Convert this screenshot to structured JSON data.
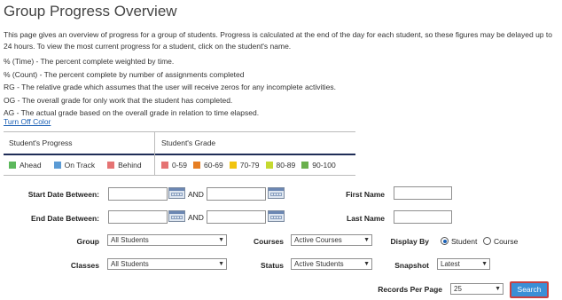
{
  "page": {
    "title": "Group Progress Overview",
    "description": "This page gives an overview of progress for a group of students. Progress is calculated at the end of the day for each student, so these figures may be delayed up to 24 hours. To view the most current progress for a student, click on the student's name.",
    "definitions": [
      "% (Time) - The percent complete weighted by time.",
      "% (Count) - The percent complete by number of assignments completed",
      "RG - The relative grade which assumes that the user will receive zeros for any incomplete activities.",
      "OG - The overall grade for only work that the student has completed.",
      "AG - The actual grade based on the overall grade in relation to time elapsed."
    ],
    "turn_off_color": "Turn Off Color"
  },
  "legend": {
    "progress_header": "Student's Progress",
    "grade_header": "Student's Grade",
    "progress_items": [
      {
        "label": "Ahead",
        "color": "#5cb85c"
      },
      {
        "label": "On Track",
        "color": "#5b9bd5"
      },
      {
        "label": "Behind",
        "color": "#e57373"
      }
    ],
    "grade_items": [
      {
        "label": "0-59",
        "color": "#e57373"
      },
      {
        "label": "60-69",
        "color": "#e67e22"
      },
      {
        "label": "70-79",
        "color": "#f1c40f"
      },
      {
        "label": "80-89",
        "color": "#c5d930"
      },
      {
        "label": "90-100",
        "color": "#6ab04c"
      }
    ]
  },
  "form": {
    "start_date_label": "Start Date Between:",
    "end_date_label": "End Date Between:",
    "and": "AND",
    "first_name_label": "First Name",
    "last_name_label": "Last Name",
    "group_label": "Group",
    "group_value": "All Students",
    "courses_label": "Courses",
    "courses_value": "Active Courses",
    "display_by_label": "Display By",
    "display_student": "Student",
    "display_course": "Course",
    "classes_label": "Classes",
    "classes_value": "All Students",
    "status_label": "Status",
    "status_value": "Active Students",
    "snapshot_label": "Snapshot",
    "snapshot_value": "Latest",
    "records_label": "Records Per Page",
    "records_value": "25",
    "search_button": "Search"
  }
}
